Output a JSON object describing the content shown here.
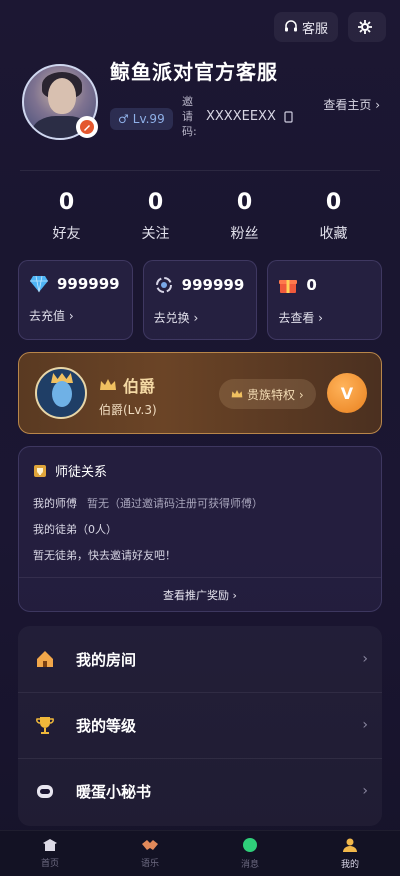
{
  "header": {
    "service_label": "客服"
  },
  "profile": {
    "name": "鲸鱼派对官方客服",
    "level": "Lv.99",
    "invite_label": "邀请码:",
    "invite_code": "XXXXEEXX",
    "homepage_label": "查看主页 ›"
  },
  "stats": [
    {
      "value": "0",
      "label": "好友"
    },
    {
      "value": "0",
      "label": "关注"
    },
    {
      "value": "0",
      "label": "粉丝"
    },
    {
      "value": "0",
      "label": "收藏"
    }
  ],
  "assets": [
    {
      "icon": "diamond-icon",
      "value": "999999",
      "action": "去充值 ›"
    },
    {
      "icon": "coin-icon",
      "value": "999999",
      "action": "去兑换 ›"
    },
    {
      "icon": "gift-icon",
      "value": "0",
      "action": "去查看 ›"
    }
  ],
  "vip": {
    "title": "伯爵",
    "sub": "伯爵(Lv.3)",
    "privilege": "贵族特权 ›",
    "badge": "V"
  },
  "mentor": {
    "title": "师徒关系",
    "master_label": "我的师傅",
    "master_value": "暂无（通过邀请码注册可获得师傅）",
    "apprentice_label": "我的徒弟（0人）",
    "empty_hint": "暂无徒弟，快去邀请好友吧！",
    "reward_link": "查看推广奖励 ›"
  },
  "menu": [
    {
      "icon": "house-icon",
      "label": "我的房间"
    },
    {
      "icon": "trophy-icon",
      "label": "我的等级"
    },
    {
      "icon": "secretary-icon",
      "label": "暖蛋小秘书"
    }
  ],
  "tabs": [
    {
      "icon": "home-icon",
      "label": "首页"
    },
    {
      "icon": "handshake-icon",
      "label": "语乐"
    },
    {
      "icon": "message-icon",
      "label": "消息"
    },
    {
      "icon": "user-icon",
      "label": "我的"
    }
  ],
  "colors": {
    "background": "#1c1733",
    "accent_gold": "#f4d9a4",
    "vip_badge": "#e9811f",
    "level_badge": "#8fb0e8"
  }
}
